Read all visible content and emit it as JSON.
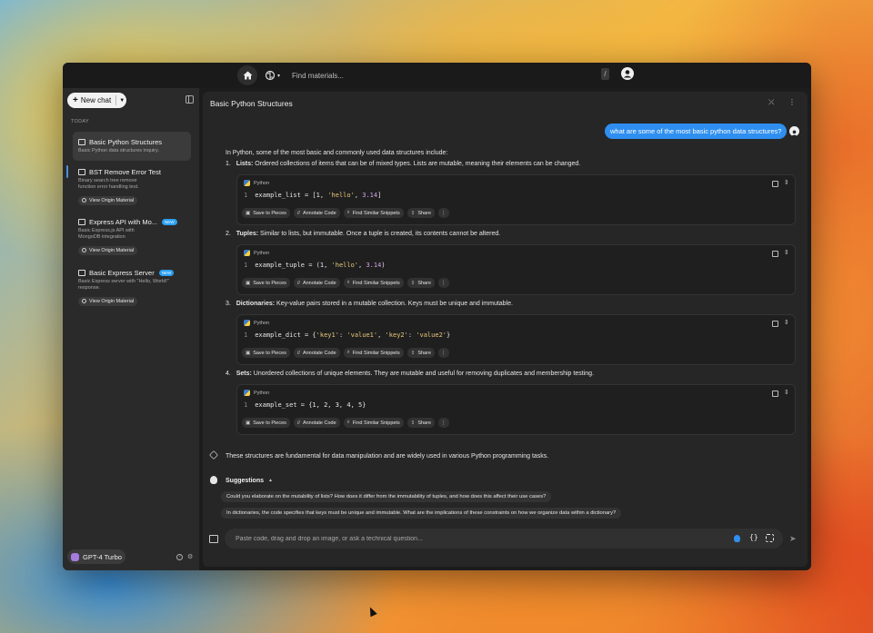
{
  "app": {
    "search": {
      "placeholder": "Find materials...",
      "shortcut": "/"
    },
    "scope_icon": "brain-icon"
  },
  "sidebar": {
    "new_chat_label": "New chat",
    "section_label": "TODAY",
    "chats": [
      {
        "title": "Basic Python Structures",
        "description": "Basic Python data structures inquiry.",
        "badge": "",
        "origin_label": "",
        "active": true
      },
      {
        "title": "BST Remove Error Test",
        "description": "Binary search tree remove function error handling test.",
        "badge": "",
        "origin_label": "View Origin Material",
        "active": false
      },
      {
        "title": "Express API with Mo...",
        "description": "Basic Express.js API with MongoDB integration",
        "badge": "NEW",
        "origin_label": "View Origin Material",
        "active": false
      },
      {
        "title": "Basic Express Server",
        "description": "Basic Express server with \"Hello, World!\" response.",
        "badge": "NEW",
        "origin_label": "View Origin Material",
        "active": false
      }
    ],
    "model_label": "GPT-4 Turbo"
  },
  "conversation": {
    "title": "Basic Python Structures",
    "user_message": "what are some of the most basic python data structures?",
    "intro": "In Python, some of the most basic and commonly used data structures include:",
    "items": [
      {
        "num": "1.",
        "name": "Lists:",
        "text": " Ordered collections of items that can be of mixed types. Lists are mutable, meaning their elements can be changed.",
        "code_parts": [
          [
            "example_list = [1, ",
            ""
          ],
          [
            "'hello'",
            "str"
          ],
          [
            ", ",
            ""
          ],
          [
            "3.14",
            "num"
          ],
          [
            "]",
            ""
          ]
        ]
      },
      {
        "num": "2.",
        "name": "Tuples:",
        "text": " Similar to lists, but immutable. Once a tuple is created, its contents cannot be altered.",
        "code_parts": [
          [
            "example_tuple = (1, ",
            ""
          ],
          [
            "'hello'",
            "str"
          ],
          [
            ", ",
            ""
          ],
          [
            "3.14",
            "num"
          ],
          [
            ")",
            ""
          ]
        ]
      },
      {
        "num": "3.",
        "name": "Dictionaries:",
        "text": " Key-value pairs stored in a mutable collection. Keys must be unique and immutable.",
        "code_parts": [
          [
            "example_dict = {",
            ""
          ],
          [
            "'key1'",
            "str"
          ],
          [
            ": ",
            ""
          ],
          [
            "'value1'",
            "str"
          ],
          [
            ", ",
            ""
          ],
          [
            "'key2'",
            "str"
          ],
          [
            ": ",
            ""
          ],
          [
            "'value2'",
            "str"
          ],
          [
            "}",
            ""
          ]
        ]
      },
      {
        "num": "4.",
        "name": "Sets:",
        "text": " Unordered collections of unique elements. They are mutable and useful for removing duplicates and membership testing.",
        "code_parts": [
          [
            "example_set = {1, 2, 3, 4, 5}",
            ""
          ]
        ]
      }
    ],
    "code_language": "Python",
    "line_number": "1",
    "actions": {
      "save": "Save to Pieces",
      "annotate": "Annotate Code",
      "similar": "Find Similar Snippets",
      "share": "Share"
    },
    "closing": "These structures are fundamental for data manipulation and are widely used in various Python programming tasks.",
    "suggestions_label": "Suggestions",
    "suggestions": [
      "Could you elaborate on the mutability of lists? How does it differ from the immutability of tuples, and how does this affect their use cases?",
      "In dictionaries, the code specifies that keys must be unique and immutable. What are the implications of these constraints on how we organize data within a dictionary?"
    ],
    "composer_placeholder": "Paste code, drag and drop an image, or ask a technical question..."
  },
  "colors": {
    "accent": "#2f8ff0",
    "window_bg": "#1c1c1c",
    "sidebar_bg": "#2a2a2a",
    "panel_bg": "#262626",
    "new_badge": "#2aa0f0"
  }
}
